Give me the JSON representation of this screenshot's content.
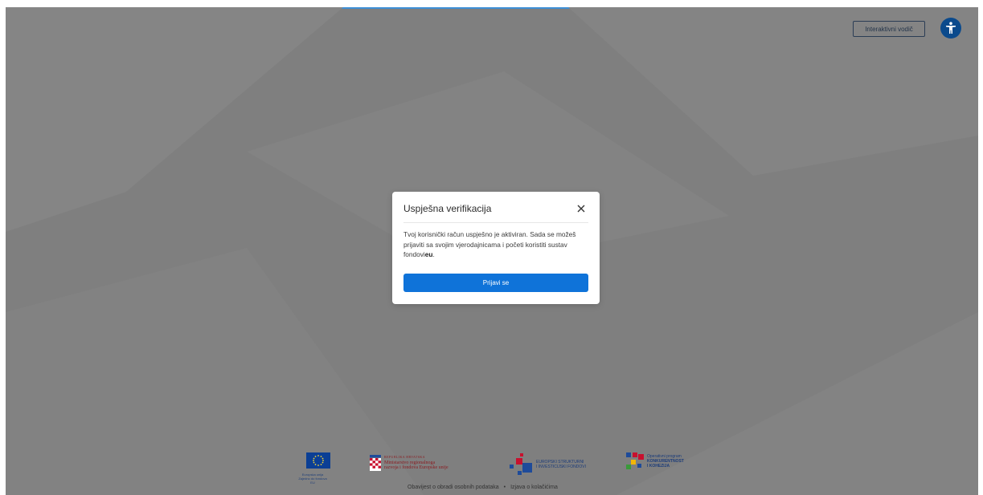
{
  "header": {
    "guide_button_label": "Interaktivni vodič",
    "accessibility_icon": "accessibility-icon"
  },
  "modal": {
    "title": "Uspješna verifikacija",
    "close_icon": "close-icon",
    "body_text": "Tvoj korisnički račun uspješno je aktiviran. Sada se možeš prijaviti sa svojim vjerodajnicama i početi koristiti sustav fondovi",
    "body_bold_suffix": "eu",
    "body_end": ".",
    "primary_button_label": "Prijavi se"
  },
  "footer": {
    "eu_caption": "Europska unija Zajedno do fondova EU",
    "ministry_line1": "REPUBLIKA HRVATSKA",
    "ministry_line2": "Ministarstvo regionalnoga",
    "ministry_line3": "razvoja i fondova Europske unije",
    "esif_line1": "EUROPSKI STRUKTURNI",
    "esif_line2": "I INVESTICIJSKI FONDOVI",
    "op_line1": "Operativni program",
    "op_line2": "KONKURENTNOST",
    "op_line3": "I KOHEZIJA",
    "link_privacy": "Obavijest o obradi osobnih podataka",
    "separator": "•",
    "link_cookies": "Izjava o kolačićima"
  },
  "colors": {
    "overlay": "#7f7f7f",
    "primary": "#0f73d9",
    "accessibility": "#0b4a8c"
  }
}
